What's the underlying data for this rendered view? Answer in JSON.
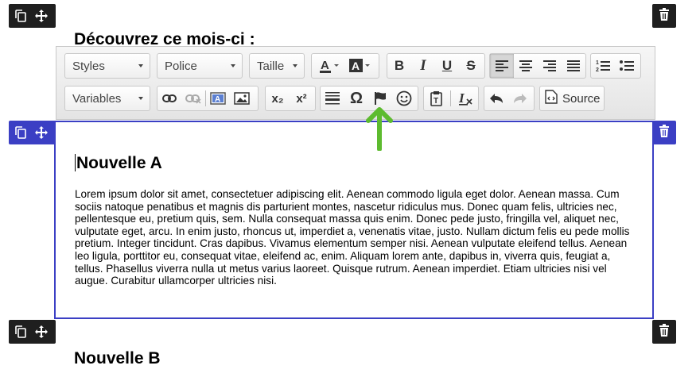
{
  "blocks": {
    "top_heading": "Découvrez ce mois-ci :",
    "active": {
      "title": "Nouvelle A",
      "body": "Lorem ipsum dolor sit amet, consectetuer adipiscing elit. Aenean commodo ligula eget dolor. Aenean massa. Cum sociis natoque penatibus et magnis dis parturient montes, nascetur ridiculus mus. Donec quam felis, ultricies nec, pellentesque eu, pretium quis, sem. Nulla consequat massa quis enim. Donec pede justo, fringilla vel, aliquet nec, vulputate eget, arcu. In enim justo, rhoncus ut, imperdiet a, venenatis vitae, justo. Nullam dictum felis eu pede mollis pretium. Integer tincidunt. Cras dapibus. Vivamus elementum semper nisi. Aenean vulputate eleifend tellus. Aenean leo ligula, porttitor eu, consequat vitae, eleifend ac, enim. Aliquam lorem ante, dapibus in, viverra quis, feugiat a, tellus. Phasellus viverra nulla ut metus varius laoreet. Quisque rutrum. Aenean imperdiet. Etiam ultricies nisi vel augue. Curabitur ullamcorper ultricies nisi."
    },
    "next_heading": "Nouvelle B"
  },
  "toolbar": {
    "styles_label": "Styles",
    "font_label": "Police",
    "size_label": "Taille",
    "variables_label": "Variables",
    "bold": "B",
    "italic": "I",
    "underline": "U",
    "strike": "S",
    "subscript": "x₂",
    "superscript": "x²",
    "special_char": "Ω",
    "source_label": "Source"
  },
  "colors": {
    "active_accent": "#3b3fc4",
    "block_bar": "#1f1f1f",
    "annotation_arrow": "#5dbb2f"
  },
  "icons": [
    "copy-icon",
    "move-icon",
    "trash-icon",
    "text-color-icon",
    "background-color-icon",
    "align-left-icon",
    "align-center-icon",
    "align-right-icon",
    "justify-icon",
    "numbered-list-icon",
    "bullet-list-icon",
    "link-icon",
    "unlink-icon",
    "textfield-icon",
    "image-icon",
    "horizontal-line-icon",
    "flag-icon",
    "smiley-icon",
    "paste-text-icon",
    "remove-format-icon",
    "undo-icon",
    "redo-icon",
    "source-icon"
  ]
}
